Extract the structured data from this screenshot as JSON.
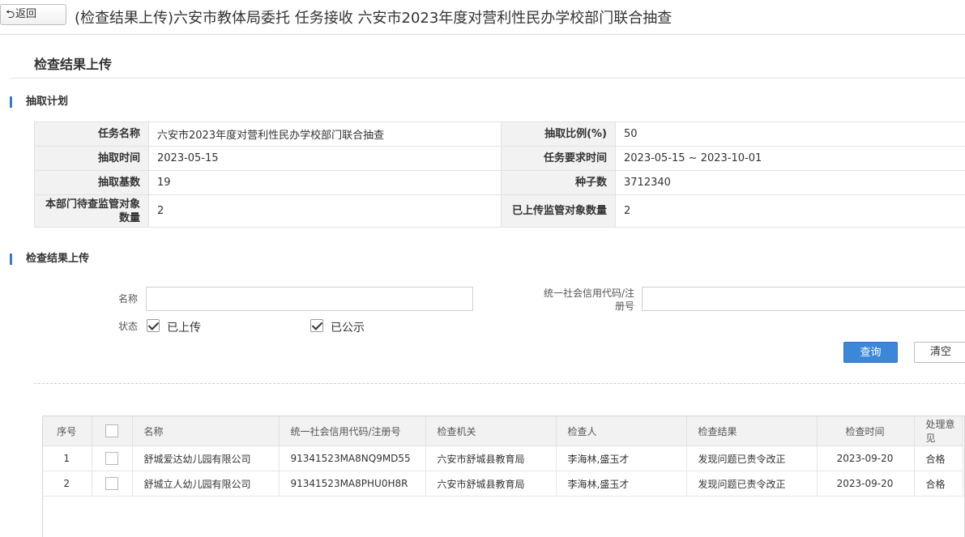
{
  "topbar": {
    "back_label": "返回",
    "title": "(检查结果上传)六安市教体局委托 任务接收 六安市2023年度对营利性民办学校部门联合抽查"
  },
  "page_title": "检查结果上传",
  "plan": {
    "section_title": "抽取计划",
    "rows": [
      {
        "k1": "任务名称",
        "v1": "六安市2023年度对营利性民办学校部门联合抽查",
        "k2": "抽取比例(%)",
        "v2": "50"
      },
      {
        "k1": "抽取时间",
        "v1": "2023-05-15",
        "k2": "任务要求时间",
        "v2": "2023-05-15 ~ 2023-10-01"
      },
      {
        "k1": "抽取基数",
        "v1": "19",
        "k2": "种子数",
        "v2": "3712340"
      },
      {
        "k1": "本部门待查监管对象数量",
        "v1": "2",
        "k2": "已上传监管对象数量",
        "v2": "2"
      }
    ]
  },
  "upload": {
    "section_title": "检查结果上传",
    "name_label": "名称",
    "name_value": "",
    "credit_label": "统一社会信用代码/注册号",
    "credit_value": "",
    "status_label": "状态",
    "status_options": [
      {
        "label": "已上传",
        "checked": true
      },
      {
        "label": "已公示",
        "checked": true
      }
    ],
    "query_label": "查询",
    "clear_label": "清空"
  },
  "results": {
    "columns": [
      "序号",
      "",
      "名称",
      "统一社会信用代码/注册号",
      "检查机关",
      "检查人",
      "检查结果",
      "检查时间",
      "处理意见"
    ],
    "rows": [
      {
        "no": "1",
        "name": "舒城爱达幼儿园有限公司",
        "code": "91341523MA8NQ9MD55",
        "authority": "六安市舒城县教育局",
        "inspector": "李海林,盛玉才",
        "result": "发现问题已责令改正",
        "date": "2023-09-20",
        "opinion": "合格"
      },
      {
        "no": "2",
        "name": "舒城立人幼儿园有限公司",
        "code": "91341523MA8PHU0H8R",
        "authority": "六安市舒城县教育局",
        "inspector": "李海林,盛玉才",
        "result": "发现问题已责令改正",
        "date": "2023-09-20",
        "opinion": "合格"
      }
    ]
  },
  "colors": {
    "accent": "#3d87d8",
    "section_bar": "#3c79c7",
    "label_bg": "#f2f2f2"
  }
}
